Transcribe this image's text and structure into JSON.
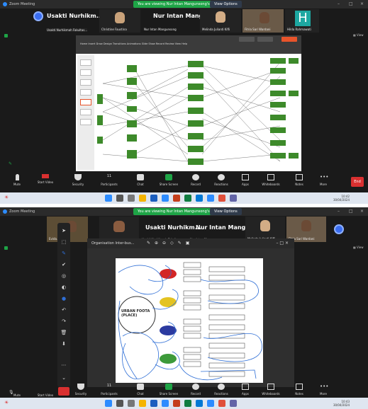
{
  "top": {
    "window_title": "Zoom Meeting",
    "share_banner": "You are viewing Nur Intan Mangunsong's screen",
    "view_options": "View Options",
    "participants": [
      {
        "name": "Usakti Nurhikm...",
        "tile_label": "Usakti Nurhikmah Fakultas...",
        "avatar": "initial-circle"
      },
      {
        "name": "",
        "tile_label": "Christine Faustina",
        "avatar": "face"
      },
      {
        "name": "Nur Intan Mang...",
        "tile_label": "Nur Intan Mangunsong",
        "avatar": "face"
      },
      {
        "name": "",
        "tile_label": "Melinda Julianti Kifli",
        "avatar": "face"
      },
      {
        "name": "",
        "tile_label": "Fitria Sari Wardani",
        "avatar": "photo"
      },
      {
        "name": "",
        "tile_label": "Hilda Rahmawati",
        "avatar": "letter",
        "letter": "H"
      }
    ],
    "ribbon_tabs": "Home  Insert  Draw  Design  Transitions  Animations  Slide Show  Record  Review  View  Help"
  },
  "toolbar": {
    "items": [
      "Mute",
      "Start Video",
      "Security",
      "Participants",
      "Chat",
      "Share Screen",
      "Record",
      "Reactions",
      "Apps",
      "Whiteboards",
      "Notes",
      "More"
    ],
    "participants_count": "11",
    "end_label": "End"
  },
  "taskbar": {
    "time1": "10:42",
    "date1": "30/04/2024",
    "time2": "10:43",
    "date2": "30/04/2024",
    "weather": "",
    "search": ""
  },
  "bottom": {
    "window_title": "Zoom Meeting",
    "share_banner": "You are viewing Nur Intan Mangunsong's screen",
    "view_options": "View Options",
    "tiles": [
      {
        "tile_label": "Evida...",
        "avatar": "photo"
      },
      {
        "tile_label": "",
        "avatar": "face"
      },
      {
        "tile_label": "Usakti Nurhikmah Fakultas...",
        "avatar": "none"
      },
      {
        "tile_label": "Nur Intan Mangunsong",
        "avatar": "none"
      },
      {
        "tile_label": "Melinda Julianti Kifli",
        "avatar": "face"
      },
      {
        "tile_label": "Fitria Sari Wardani",
        "avatar": "photo"
      }
    ],
    "big_names": [
      "Usakti Nurhikm...",
      "Nur Intan Mang..."
    ],
    "pdf_title": "Organisation Inter-bus...",
    "diagram_title": "URBAN FOOTA\n(PLACE)",
    "diagram_caption": ""
  },
  "colors": {
    "zoom_blue": "#2d8cff",
    "share_green": "#1ea446",
    "end_red": "#d93030",
    "diagram_green": "#3d8a2a",
    "annotation_blue": "#2f6fd6"
  }
}
